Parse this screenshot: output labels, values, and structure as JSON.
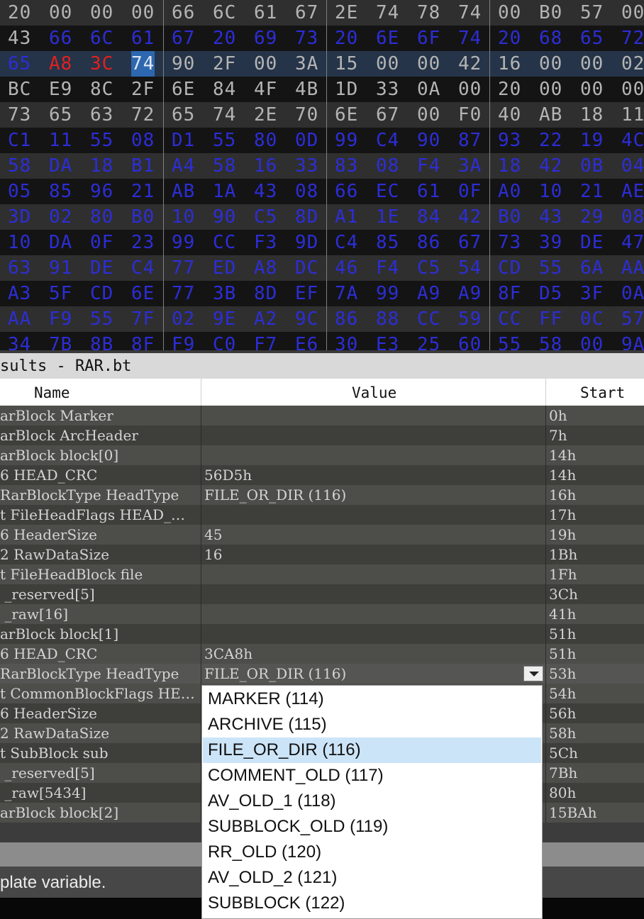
{
  "hex_view": {
    "rows": [
      {
        "bytes": [
          "20",
          "00",
          "00",
          "00",
          "66",
          "6C",
          "61",
          "67",
          "2E",
          "74",
          "78",
          "74",
          "00",
          "B0",
          "57",
          "00"
        ],
        "colors": [
          "gray",
          "gray",
          "gray",
          "gray",
          "gray",
          "gray",
          "gray",
          "gray",
          "gray",
          "gray",
          "gray",
          "gray",
          "gray",
          "gray",
          "gray",
          "gray"
        ]
      },
      {
        "bytes": [
          "43",
          "66",
          "6C",
          "61",
          "67",
          "20",
          "69",
          "73",
          "20",
          "6E",
          "6F",
          "74",
          "20",
          "68",
          "65",
          "72"
        ],
        "colors": [
          "gray",
          "blue",
          "blue",
          "blue",
          "blue",
          "blue",
          "blue",
          "blue",
          "blue",
          "blue",
          "blue",
          "blue",
          "blue",
          "blue",
          "blue",
          "blue"
        ]
      },
      {
        "bytes": [
          "65",
          "A8",
          "3C",
          "74",
          "90",
          "2F",
          "00",
          "3A",
          "15",
          "00",
          "00",
          "42",
          "16",
          "00",
          "00",
          "02"
        ],
        "colors": [
          "blue",
          "red",
          "red",
          "selected",
          "gray",
          "gray",
          "gray",
          "gray",
          "gray",
          "gray",
          "gray",
          "gray",
          "gray",
          "gray",
          "gray",
          "gray"
        ],
        "current": true
      },
      {
        "bytes": [
          "BC",
          "E9",
          "8C",
          "2F",
          "6E",
          "84",
          "4F",
          "4B",
          "1D",
          "33",
          "0A",
          "00",
          "20",
          "00",
          "00",
          "00"
        ],
        "colors": [
          "gray",
          "gray",
          "gray",
          "gray",
          "gray",
          "gray",
          "gray",
          "gray",
          "gray",
          "gray",
          "gray",
          "gray",
          "gray",
          "gray",
          "gray",
          "gray"
        ]
      },
      {
        "bytes": [
          "73",
          "65",
          "63",
          "72",
          "65",
          "74",
          "2E",
          "70",
          "6E",
          "67",
          "00",
          "F0",
          "40",
          "AB",
          "18",
          "11"
        ],
        "colors": [
          "gray",
          "gray",
          "gray",
          "gray",
          "gray",
          "gray",
          "gray",
          "gray",
          "gray",
          "gray",
          "gray",
          "gray",
          "gray",
          "gray",
          "gray",
          "gray"
        ]
      },
      {
        "bytes": [
          "C1",
          "11",
          "55",
          "08",
          "D1",
          "55",
          "80",
          "0D",
          "99",
          "C4",
          "90",
          "87",
          "93",
          "22",
          "19",
          "4C"
        ],
        "colors": [
          "blue",
          "blue",
          "blue",
          "blue",
          "blue",
          "blue",
          "blue",
          "blue",
          "blue",
          "blue",
          "blue",
          "blue",
          "blue",
          "blue",
          "blue",
          "blue"
        ]
      },
      {
        "bytes": [
          "58",
          "DA",
          "18",
          "B1",
          "A4",
          "58",
          "16",
          "33",
          "83",
          "08",
          "F4",
          "3A",
          "18",
          "42",
          "0B",
          "04"
        ],
        "colors": [
          "blue",
          "blue",
          "blue",
          "blue",
          "blue",
          "blue",
          "blue",
          "blue",
          "blue",
          "blue",
          "blue",
          "blue",
          "blue",
          "blue",
          "blue",
          "blue"
        ]
      },
      {
        "bytes": [
          "05",
          "85",
          "96",
          "21",
          "AB",
          "1A",
          "43",
          "08",
          "66",
          "EC",
          "61",
          "0F",
          "A0",
          "10",
          "21",
          "AE"
        ],
        "colors": [
          "blue",
          "blue",
          "blue",
          "blue",
          "blue",
          "blue",
          "blue",
          "blue",
          "blue",
          "blue",
          "blue",
          "blue",
          "blue",
          "blue",
          "blue",
          "blue"
        ]
      },
      {
        "bytes": [
          "3D",
          "02",
          "80",
          "B0",
          "10",
          "90",
          "C5",
          "8D",
          "A1",
          "1E",
          "84",
          "42",
          "B0",
          "43",
          "29",
          "08"
        ],
        "colors": [
          "blue",
          "blue",
          "blue",
          "blue",
          "blue",
          "blue",
          "blue",
          "blue",
          "blue",
          "blue",
          "blue",
          "blue",
          "blue",
          "blue",
          "blue",
          "blue"
        ]
      },
      {
        "bytes": [
          "10",
          "DA",
          "0F",
          "23",
          "99",
          "CC",
          "F3",
          "9D",
          "C4",
          "85",
          "86",
          "67",
          "73",
          "39",
          "DE",
          "47"
        ],
        "colors": [
          "blue",
          "blue",
          "blue",
          "blue",
          "blue",
          "blue",
          "blue",
          "blue",
          "blue",
          "blue",
          "blue",
          "blue",
          "blue",
          "blue",
          "blue",
          "blue"
        ]
      },
      {
        "bytes": [
          "63",
          "91",
          "DE",
          "C4",
          "77",
          "ED",
          "A8",
          "DC",
          "46",
          "F4",
          "C5",
          "54",
          "CD",
          "55",
          "6A",
          "AA"
        ],
        "colors": [
          "blue",
          "blue",
          "blue",
          "blue",
          "blue",
          "blue",
          "blue",
          "blue",
          "blue",
          "blue",
          "blue",
          "blue",
          "blue",
          "blue",
          "blue",
          "blue"
        ]
      },
      {
        "bytes": [
          "A3",
          "5F",
          "CD",
          "6E",
          "77",
          "3B",
          "8D",
          "EF",
          "7A",
          "99",
          "A9",
          "A9",
          "8F",
          "D5",
          "3F",
          "0A"
        ],
        "colors": [
          "blue",
          "blue",
          "blue",
          "blue",
          "blue",
          "blue",
          "blue",
          "blue",
          "blue",
          "blue",
          "blue",
          "blue",
          "blue",
          "blue",
          "blue",
          "blue"
        ]
      },
      {
        "bytes": [
          "AA",
          "F9",
          "55",
          "7F",
          "02",
          "9E",
          "A2",
          "9C",
          "86",
          "88",
          "CC",
          "59",
          "CC",
          "FF",
          "0C",
          "57"
        ],
        "colors": [
          "blue",
          "blue",
          "blue",
          "blue",
          "blue",
          "blue",
          "blue",
          "blue",
          "blue",
          "blue",
          "blue",
          "blue",
          "blue",
          "blue",
          "blue",
          "blue"
        ]
      },
      {
        "bytes": [
          "34",
          "7B",
          "8B",
          "8F",
          "F9",
          "C0",
          "F7",
          "E6",
          "30",
          "E3",
          "25",
          "60",
          "55",
          "58",
          "00",
          "9A"
        ],
        "colors": [
          "blue",
          "blue",
          "blue",
          "blue",
          "blue",
          "blue",
          "blue",
          "blue",
          "blue",
          "blue",
          "blue",
          "blue",
          "blue",
          "blue",
          "blue",
          "blue"
        ]
      }
    ],
    "colors": {
      "gray": "#b4b4b4",
      "blue": "#2d2dd8",
      "red": "#e02020",
      "selected_bg": "#2d67b0"
    }
  },
  "results_panel": {
    "title": "sults - RAR.bt",
    "columns": {
      "name": "Name",
      "value": "Value",
      "start": "Start"
    },
    "rows": [
      {
        "name": "arBlock Marker",
        "value": "",
        "start": "0h"
      },
      {
        "name": "arBlock ArcHeader",
        "value": "",
        "start": "7h"
      },
      {
        "name": "arBlock block[0]",
        "value": "",
        "start": "14h"
      },
      {
        "name": "6 HEAD_CRC",
        "value": "56D5h",
        "start": "14h"
      },
      {
        "name": "RarBlockType HeadType",
        "value": "FILE_OR_DIR (116)",
        "start": "16h"
      },
      {
        "name": "t FileHeadFlags HEAD_…",
        "value": "",
        "start": "17h"
      },
      {
        "name": "6 HeaderSize",
        "value": "45",
        "start": "19h"
      },
      {
        "name": "2 RawDataSize",
        "value": "16",
        "start": "1Bh"
      },
      {
        "name": "t FileHeadBlock file",
        "value": "",
        "start": "1Fh"
      },
      {
        "name": " _reserved[5]",
        "value": "",
        "start": "3Ch"
      },
      {
        "name": " _raw[16]",
        "value": "",
        "start": "41h"
      },
      {
        "name": "arBlock block[1]",
        "value": "",
        "start": "51h"
      },
      {
        "name": "6 HEAD_CRC",
        "value": "3CA8h",
        "start": "51h"
      },
      {
        "name": "RarBlockType HeadType",
        "value": "FILE_OR_DIR (116)",
        "start": "53h",
        "editing": true
      },
      {
        "name": "t CommonBlockFlags HE…",
        "value": "",
        "start": "54h"
      },
      {
        "name": "6 HeaderSize",
        "value": "",
        "start": "56h"
      },
      {
        "name": "2 RawDataSize",
        "value": "",
        "start": "58h"
      },
      {
        "name": "t SubBlock sub",
        "value": "",
        "start": "5Ch"
      },
      {
        "name": " _reserved[5]",
        "value": "",
        "start": "7Bh"
      },
      {
        "name": " _raw[5434]",
        "value": "",
        "start": "80h"
      },
      {
        "name": "arBlock block[2]",
        "value": "",
        "start": "15BAh"
      }
    ],
    "dropdown_icon": "chevron-down-icon",
    "dropdown_options": [
      "MARKER (114)",
      "ARCHIVE (115)",
      "FILE_OR_DIR (116)",
      "COMMENT_OLD (117)",
      "AV_OLD_1 (118)",
      "SUBBLOCK_OLD (119)",
      "RR_OLD (120)",
      "AV_OLD_2 (121)",
      "SUBBLOCK (122)"
    ],
    "selected_option": "FILE_OR_DIR (116)"
  },
  "status_bar": {
    "text": "plate variable."
  }
}
